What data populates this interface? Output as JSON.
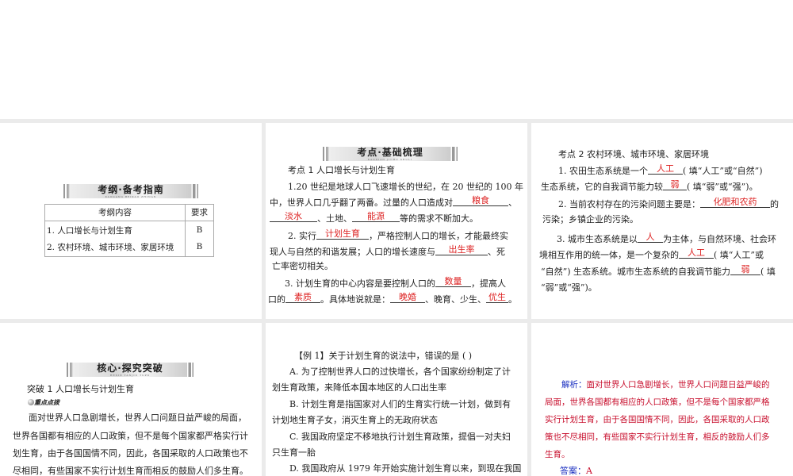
{
  "p1": {
    "banner": "考纲·备考指南",
    "banner_sub": "KAOGANG   BEIKAO ZHINAN",
    "col1": "考纲内容",
    "col2": "要求",
    "rows": [
      {
        "item": "1. 人口增长与计划生育",
        "req": "B"
      },
      {
        "item": "2. 农村环境、城市环境、家居环境",
        "req": "B"
      }
    ]
  },
  "p2": {
    "banner": "考点·基础梳理",
    "banner_sub": "KAODIAN   JICHU SHULI",
    "heading": "考点  1   人口增长与计划生育",
    "l1": "1.20 世纪是地球人口飞速增长的世纪，在  20 世纪的  100 年",
    "l2a": "中，世界人口几乎翻了两番。过量的人口造成对",
    "a1": "粮食",
    "l2b": "、",
    "a2": "淡水",
    "l3a": "、土地、",
    "a3": "能源",
    "l3b": "等的需求不断加大。",
    "l4a": "2. 实行",
    "a4": "计划生育",
    "l4b": "，严格控制人口的增长，才能最终实",
    "l5a": "现人与自然的和谐发展；人口的增长速度与",
    "a5": "出生率",
    "l5b": "、死",
    "l6": "亡率密切相关。",
    "l7a": "3. 计划生育的中心内容是要控制人口的",
    "a6": "数量",
    "l7b": "，提高人",
    "l8a": "口的",
    "a7": "素质",
    "l8b": "。具体地说就是：",
    "a8": "晚婚",
    "l8c": "、晚育、少生、",
    "a9": "优生",
    "l8d": "。"
  },
  "p3": {
    "heading": "考点  2   农村环境、城市环境、家居环境",
    "l1a": "1. 农田生态系统是一个",
    "a1": "人工",
    "l1b": "( 填“人工”或“自然”)",
    "l2a": "生态系统，它的自我调节能力较",
    "a2": "弱",
    "l2b": "( 填“弱”或“强”)。",
    "l3a": "2. 当前农村存在的污染问题主要是：",
    "a3": "化肥和农药",
    "l3b": "的",
    "l4": "污染；乡镇企业的污染。",
    "l5a": "3. 城市生态系统是以",
    "a4": "人",
    "l5b": "为主体，与自然环境、社会环",
    "l6a": "境相互作用的统一体，是一个复杂的",
    "a5": "人工",
    "l6b": "( 填“人工”或",
    "l7a": "“自然”) 生态系统。城市生态系统的自我调节能力",
    "a6": "弱",
    "l7b": "( 填",
    "l8": "“弱”或“强”)。"
  },
  "p4": {
    "banner": "核心·探究突破",
    "banner_sub": "HEXIN    TANJIU TUPO",
    "heading": "突破  1   人口增长与计划生育",
    "tag": "重点点拨",
    "lines": [
      "面对世界人口急剧增长，世界人口问题日益严峻的局面，",
      "世界各国都有相应的人口政策，但不是每个国家都严格实行计",
      "划生育，由于各国国情不同，因此，各国采取的人口政策也不",
      "尽相同，有些国家不实行计划生育而相反的鼓励人们多生育。"
    ]
  },
  "p5": {
    "lines": [
      "【例  1】关于计划生育的说法中，错误的是 (     )",
      "A. 为了控制世界人口的过快增长，各个国家纷纷制定了计",
      "划生育政策，来降低本国本地区的人口出生率",
      "B. 计划生育是指国家对人们的生育实行统一计划，做到有",
      "计划地生育子女，消灭生育上的无政府状态",
      "C. 我国政府坚定不移地执行计划生育政策，提倡一对夫妇",
      "只生育一胎",
      "D. 我国政府从  1979  年开始实施计划生育以来，到现在我国"
    ]
  },
  "p6": {
    "label": "解析：",
    "lines": [
      "面对世界人口急剧增长，世界人口问题日益严峻的",
      "局面，世界各国都有相应的人口政策，但不是每个国家都严格",
      "实行计划生育，由于各国国情不同，因此，各国采取的人口政",
      "策也不尽相同，有些国家不实行计划生育，相反的鼓励人们多",
      "生育。"
    ],
    "answer_label": "答案：",
    "answer": "A"
  }
}
